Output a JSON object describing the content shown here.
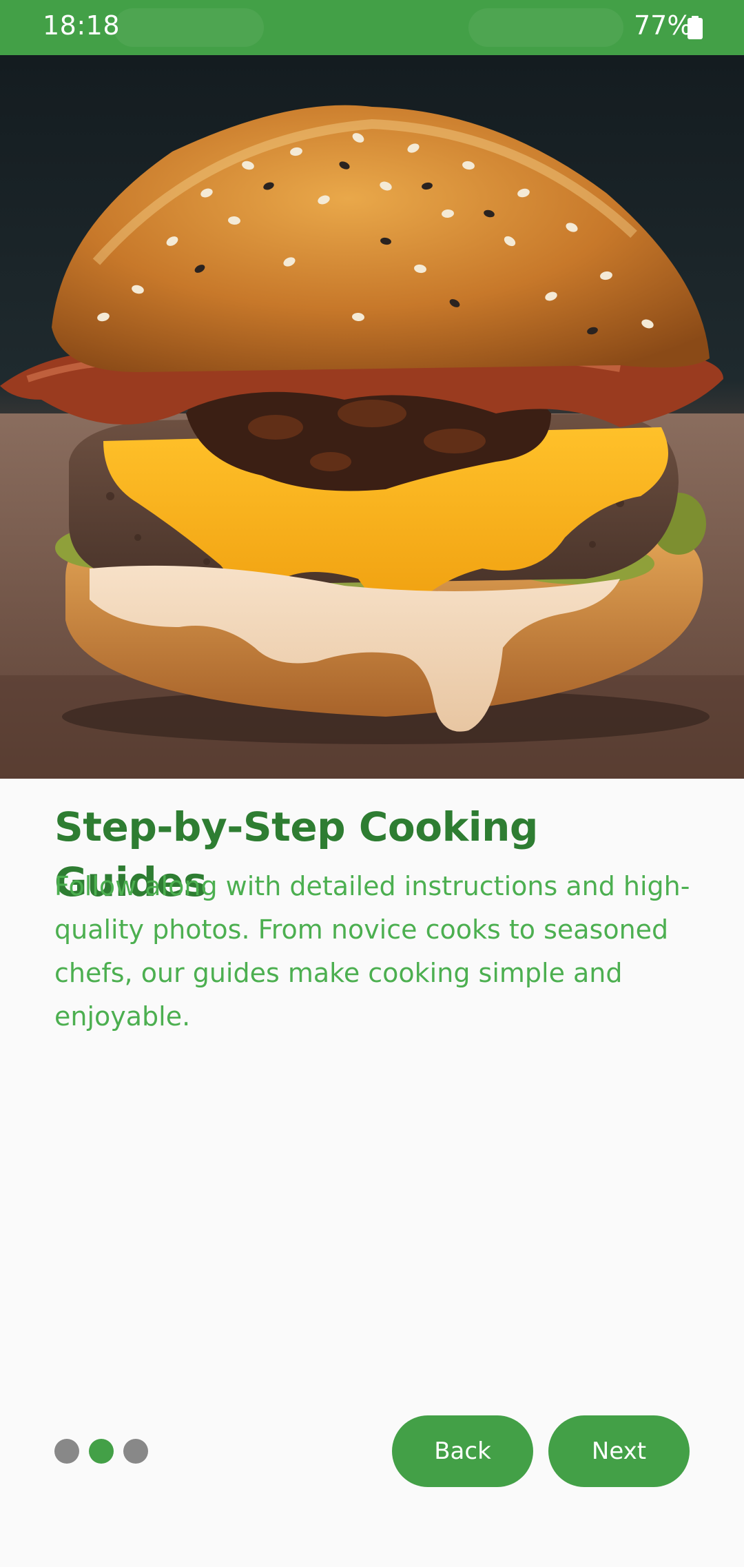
{
  "status_bar": {
    "time": "18:18",
    "battery": "77%",
    "background_color": "#43A047"
  },
  "hero": {
    "image_subject": "burger photo",
    "icon": "burger-photo"
  },
  "onboarding": {
    "title": "Step-by-Step Cooking Guides",
    "description": "Follow along with detailed instructions and high-quality photos. From novice cooks to seasoned chefs, our guides make cooking simple and enjoyable.",
    "page_index": 2,
    "page_count": 3
  },
  "buttons": {
    "back_label": "Back",
    "next_label": "Next"
  },
  "colors": {
    "accent": "#43A047",
    "title": "#2E7D32",
    "body": "#4CAF50",
    "inactive_dot": "#888888",
    "background": "#FAFAFA"
  }
}
